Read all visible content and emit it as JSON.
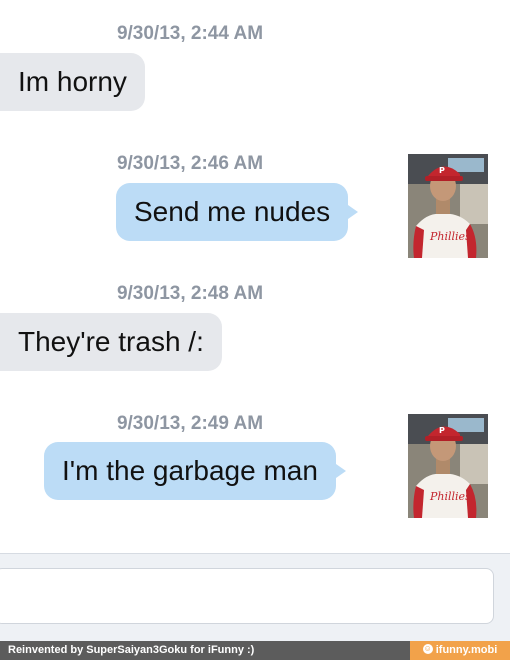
{
  "messages": [
    {
      "timestamp": "9/30/13, 2:44 AM",
      "text": "Im horny",
      "direction": "incoming"
    },
    {
      "timestamp": "9/30/13, 2:46 AM",
      "text": "Send me nudes",
      "direction": "outgoing"
    },
    {
      "timestamp": "9/30/13, 2:48 AM",
      "text": "They're trash /:",
      "direction": "incoming"
    },
    {
      "timestamp": "9/30/13, 2:49 AM",
      "text": "I'm the garbage man",
      "direction": "outgoing"
    }
  ],
  "compose": {
    "placeholder": ""
  },
  "watermark": {
    "left_text": "Reinvented by SuperSaiyan3Goku for iFunny :)",
    "right_text": "ifunny.mobi",
    "right_icon": "smile-icon"
  },
  "colors": {
    "incoming_bubble": "#e6e8ec",
    "outgoing_bubble": "#bcdcf6",
    "timestamp": "#8e96a2",
    "footer_left": "#5c5c5c",
    "footer_right": "#f2a24a"
  }
}
